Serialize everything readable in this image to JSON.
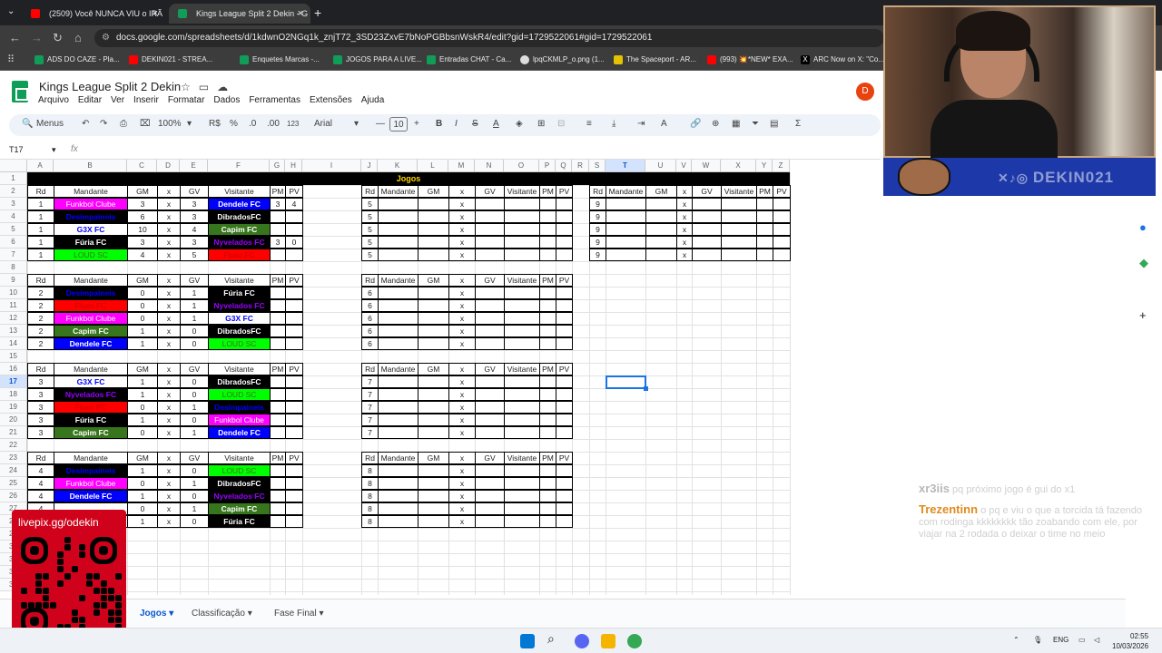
{
  "browser": {
    "tabs": [
      {
        "title": "(2509) Você NUNCA VIU o IRÃ",
        "active": false
      },
      {
        "title": "Kings League Split 2 Dekin - G",
        "active": true
      }
    ],
    "new_tab": "+",
    "url": "docs.google.com/spreadsheets/d/1kdwnO2NGq1k_znjT72_3SD23ZxvE7bNoPGBbsnWskR4/edit?gid=1729522061#gid=1729522061",
    "bookmarks": [
      "ADS DO CAZE - Pla...",
      "DEKIN021 - STREA...",
      "Enquetes Marcas -...",
      "JOGOS PARA A LIVE...",
      "Entradas CHAT - Ca...",
      "lpqCKMLP_o.png (1...",
      "The Spaceport - AR...",
      "(993) 💥*NEW* EXA...",
      "ARC Now on X: \"Co..."
    ]
  },
  "doc": {
    "title": "Kings League Split 2  Dekin",
    "menus": [
      "Arquivo",
      "Editar",
      "Ver",
      "Inserir",
      "Formatar",
      "Dados",
      "Ferramentas",
      "Extensões",
      "Ajuda"
    ],
    "avatar": "D",
    "toolbar": {
      "search": "Menus",
      "zoom": "100%",
      "currency": "R$",
      "percent": "%",
      "dec_less": ".0",
      "dec_more": ".00",
      "format": "123",
      "font": "Arial",
      "font_size": "10"
    },
    "namebox": "T17",
    "fx": "fx"
  },
  "columns": [
    "A",
    "B",
    "C",
    "D",
    "E",
    "F",
    "G",
    "H",
    "I",
    "J",
    "K",
    "L",
    "M",
    "N",
    "O",
    "P",
    "Q",
    "R",
    "S",
    "T",
    "U",
    "V",
    "W",
    "X",
    "Y",
    "Z"
  ],
  "selected_column": "T",
  "selected_row": "17",
  "banner": "Jogos",
  "colors": {
    "magenta": "#ff00ff",
    "black": "#000000",
    "blue": "#0000ff",
    "green": "#38761d",
    "limegreen": "#00ff00",
    "red": "#ff0000",
    "purpletext": "#9900ff",
    "yellowtext": "#ffd400"
  },
  "header_row": {
    "rd": "Rd",
    "mandante": "Mandante",
    "gm": "GM",
    "x": "x",
    "gv": "GV",
    "visitante": "Visitante",
    "pm": "PM",
    "pv": "PV"
  },
  "blocks": [
    {
      "top_row": 2,
      "games": [
        {
          "rd": "1",
          "home": "Funkbol Clube",
          "home_style": "magenta",
          "gm": "3",
          "gv": "3",
          "away": "Dendele FC",
          "away_style": "blue",
          "pm": "3",
          "pv": "4"
        },
        {
          "rd": "1",
          "home": "Desimpaineis",
          "home_style": "black-blue",
          "gm": "6",
          "gv": "3",
          "away": "DibradosFC",
          "away_style": "black",
          "pm": "",
          "pv": ""
        },
        {
          "rd": "1",
          "home": "G3X FC",
          "home_style": "white",
          "gm": "10",
          "gv": "4",
          "away": "Capim FC",
          "away_style": "green",
          "pm": "",
          "pv": ""
        },
        {
          "rd": "1",
          "home": "Fúria FC",
          "home_style": "black",
          "gm": "3",
          "gv": "3",
          "away": "Nyvelados FC",
          "away_style": "black-purple",
          "pm": "3",
          "pv": "0"
        },
        {
          "rd": "1",
          "home": "LOUD SC",
          "home_style": "lime",
          "gm": "4",
          "gv": "5",
          "away": "Fluxo FC",
          "away_style": "red",
          "pm": "",
          "pv": ""
        }
      ]
    },
    {
      "top_row": 9,
      "games": [
        {
          "rd": "2",
          "home": "Desimpaineis",
          "home_style": "black-blue",
          "gm": "0",
          "gv": "1",
          "away": "Fúria FC",
          "away_style": "black",
          "pm": "",
          "pv": ""
        },
        {
          "rd": "2",
          "home": "Fluxo FC",
          "home_style": "red",
          "gm": "0",
          "gv": "1",
          "away": "Nyvelados FC",
          "away_style": "black-purple",
          "pm": "",
          "pv": ""
        },
        {
          "rd": "2",
          "home": "Funkbol Clube",
          "home_style": "magenta",
          "gm": "0",
          "gv": "1",
          "away": "G3X FC",
          "away_style": "white",
          "pm": "",
          "pv": ""
        },
        {
          "rd": "2",
          "home": "Capim FC",
          "home_style": "green",
          "gm": "1",
          "gv": "0",
          "away": "DibradosFC",
          "away_style": "black",
          "pm": "",
          "pv": ""
        },
        {
          "rd": "2",
          "home": "Dendele FC",
          "home_style": "blue",
          "gm": "1",
          "gv": "0",
          "away": "LOUD SC",
          "away_style": "lime",
          "pm": "",
          "pv": ""
        }
      ]
    },
    {
      "top_row": 16,
      "games": [
        {
          "rd": "3",
          "home": "G3X FC",
          "home_style": "white",
          "gm": "1",
          "gv": "0",
          "away": "DibradosFC",
          "away_style": "black",
          "pm": "",
          "pv": ""
        },
        {
          "rd": "3",
          "home": "Nyvelados FC",
          "home_style": "black-purple",
          "gm": "1",
          "gv": "0",
          "away": "LOUD SC",
          "away_style": "lime",
          "pm": "",
          "pv": ""
        },
        {
          "rd": "3",
          "home": "Fluxo FC",
          "home_style": "red",
          "gm": "0",
          "gv": "1",
          "away": "Desimpaineis",
          "away_style": "black-blue",
          "pm": "",
          "pv": ""
        },
        {
          "rd": "3",
          "home": "Fúria FC",
          "home_style": "black",
          "gm": "1",
          "gv": "0",
          "away": "Funkbol Clube",
          "away_style": "magenta",
          "pm": "",
          "pv": ""
        },
        {
          "rd": "3",
          "home": "Capim FC",
          "home_style": "green",
          "gm": "0",
          "gv": "1",
          "away": "Dendele FC",
          "away_style": "blue",
          "pm": "",
          "pv": ""
        }
      ]
    },
    {
      "top_row": 23,
      "games": [
        {
          "rd": "4",
          "home": "Desimpaineis",
          "home_style": "black-blue",
          "gm": "1",
          "gv": "0",
          "away": "LOUD SC",
          "away_style": "lime",
          "pm": "",
          "pv": ""
        },
        {
          "rd": "4",
          "home": "Funkbol Clube",
          "home_style": "magenta",
          "gm": "0",
          "gv": "1",
          "away": "DibradosFC",
          "away_style": "black",
          "pm": "",
          "pv": ""
        },
        {
          "rd": "4",
          "home": "Dendele FC",
          "home_style": "blue",
          "gm": "1",
          "gv": "0",
          "away": "Nyvelados FC",
          "away_style": "black-purple",
          "pm": "",
          "pv": ""
        },
        {
          "rd": "4",
          "home": "",
          "home_style": "white",
          "gm": "0",
          "gv": "1",
          "away": "Capim FC",
          "away_style": "green",
          "pm": "",
          "pv": ""
        },
        {
          "rd": "4",
          "home": "",
          "home_style": "white",
          "gm": "1",
          "gv": "0",
          "away": "Fúria FC",
          "away_style": "black",
          "pm": "",
          "pv": ""
        }
      ]
    }
  ],
  "empty_blocks_mid": [
    {
      "top_row": 2,
      "rd": "5"
    },
    {
      "top_row": 9,
      "rd": "6"
    },
    {
      "top_row": 16,
      "rd": "7"
    },
    {
      "top_row": 23,
      "rd": "8"
    }
  ],
  "empty_blocks_right": [
    {
      "top_row": 2,
      "rd": "9"
    }
  ],
  "sheet_tabs": [
    "Jogos",
    "Classificação",
    "Fase Final"
  ],
  "active_sheet": "Jogos",
  "overlay": {
    "channel": "DEKIN021",
    "livepix": "livepix.gg/odekin",
    "chat": [
      {
        "user": "xr3iis",
        "msg": "pq próximo jogo é gui do x1"
      },
      {
        "user": "Trezentinn",
        "msg": "o pq e viu o que a torcida tá fazendo com rodinga kkkkkkkk tão zoabando com ele, por viajar na 2 rodada o deixar o time no meio"
      }
    ]
  },
  "taskbar": {
    "lang": "ENG",
    "time": "02:55",
    "date": "10/03/2026"
  }
}
